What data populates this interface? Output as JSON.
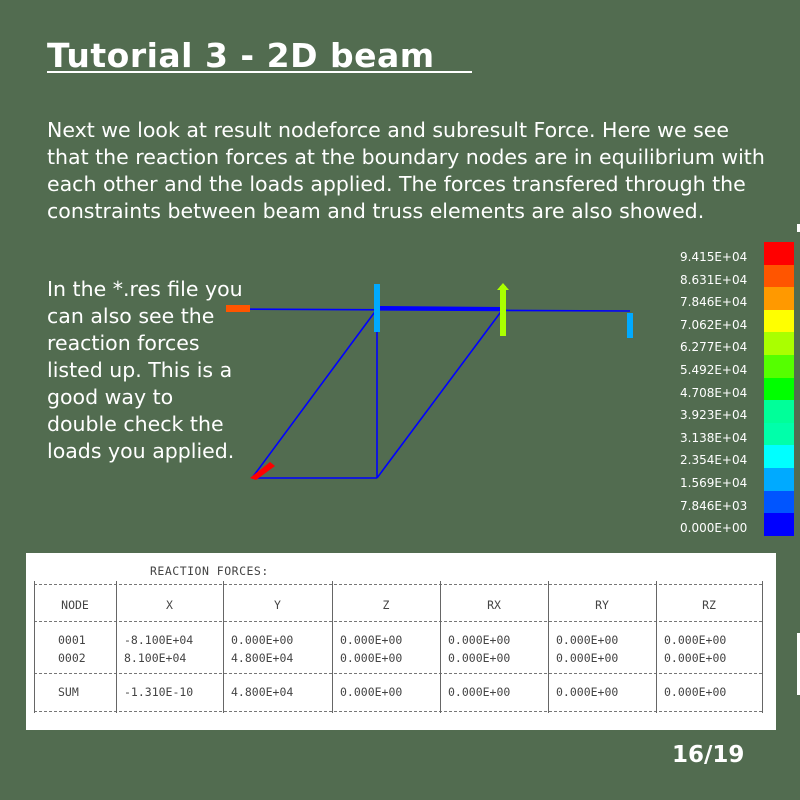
{
  "slide": {
    "title": "Tutorial 3 - 2D beam",
    "intro": "Next we look at result nodeforce and subresult Force. Here we see that the reaction forces at the boundary nodes are in equilibrium with each other and the loads applied. The forces transfered through the constraints between beam and truss elements are also showed.",
    "side_text": "In the *.res file you can also see the reaction forces listed up. This is a good way to double check the loads you applied.",
    "page_number": "16/19"
  },
  "legend": {
    "labels": [
      "9.415E+04",
      "8.631E+04",
      "7.846E+04",
      "7.062E+04",
      "6.277E+04",
      "5.492E+04",
      "4.708E+04",
      "3.923E+04",
      "3.138E+04",
      "2.354E+04",
      "1.569E+04",
      "7.846E+03",
      "0.000E+00"
    ],
    "colors": [
      "#ff0000",
      "#ff5500",
      "#ff9900",
      "#ffff00",
      "#aaff00",
      "#55ff00",
      "#00ff00",
      "#00ff99",
      "#00ffaa",
      "#00ffff",
      "#00aaff",
      "#0055ff",
      "#0000ff"
    ]
  },
  "model_colors": {
    "beam": "#0000ff",
    "arrow_left": "#ff5500",
    "arrow_mid": "#00aaff",
    "arrow_top": "#aaff00",
    "arrow_right": "#00aaff",
    "arrow_bottom": "#ff0000"
  },
  "table": {
    "caption": "REACTION FORCES:",
    "headers": [
      "NODE",
      "X",
      "Y",
      "Z",
      "RX",
      "RY",
      "RZ"
    ],
    "rows": [
      [
        "0001",
        "-8.100E+04",
        "0.000E+00",
        "0.000E+00",
        "0.000E+00",
        "0.000E+00",
        "0.000E+00"
      ],
      [
        "0002",
        "8.100E+04",
        "4.800E+04",
        "0.000E+00",
        "0.000E+00",
        "0.000E+00",
        "0.000E+00"
      ]
    ],
    "sum": [
      "SUM",
      "-1.310E-10",
      "4.800E+04",
      "0.000E+00",
      "0.000E+00",
      "0.000E+00",
      "0.000E+00"
    ]
  }
}
